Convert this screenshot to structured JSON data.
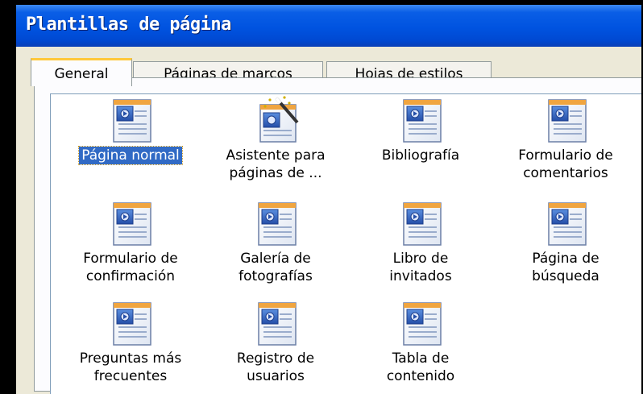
{
  "window": {
    "title": "Plantillas de página"
  },
  "tabs": [
    {
      "label": "General",
      "active": true
    },
    {
      "label": "Páginas de marcos",
      "active": false
    },
    {
      "label": "Hojas de estilos",
      "active": false
    }
  ],
  "templates": [
    {
      "label": "Página normal",
      "icon": "document-page-icon",
      "selected": true
    },
    {
      "label": "Asistente para\npáginas de ...",
      "icon": "wizard-icon",
      "selected": false
    },
    {
      "label": "Bibliografía",
      "icon": "document-page-icon",
      "selected": false
    },
    {
      "label": "Formulario de\ncomentarios",
      "icon": "document-page-icon",
      "selected": false
    },
    {
      "label": "Formulario de\nconfirmación",
      "icon": "document-page-icon",
      "selected": false
    },
    {
      "label": "Galería de\nfotografías",
      "icon": "document-page-icon",
      "selected": false
    },
    {
      "label": "Libro de\ninvitados",
      "icon": "document-page-icon",
      "selected": false
    },
    {
      "label": "Página de\nbúsqueda",
      "icon": "document-page-icon",
      "selected": false
    },
    {
      "label": "Preguntas más\nfrecuentes",
      "icon": "document-page-icon",
      "selected": false
    },
    {
      "label": "Registro de\nusuarios",
      "icon": "document-page-icon",
      "selected": false
    },
    {
      "label": "Tabla de\ncontenido",
      "icon": "document-page-icon",
      "selected": false
    }
  ],
  "colors": {
    "title_bar": "#0053e0",
    "selection": "#316ac5",
    "tab_highlight": "#ffc83c"
  }
}
